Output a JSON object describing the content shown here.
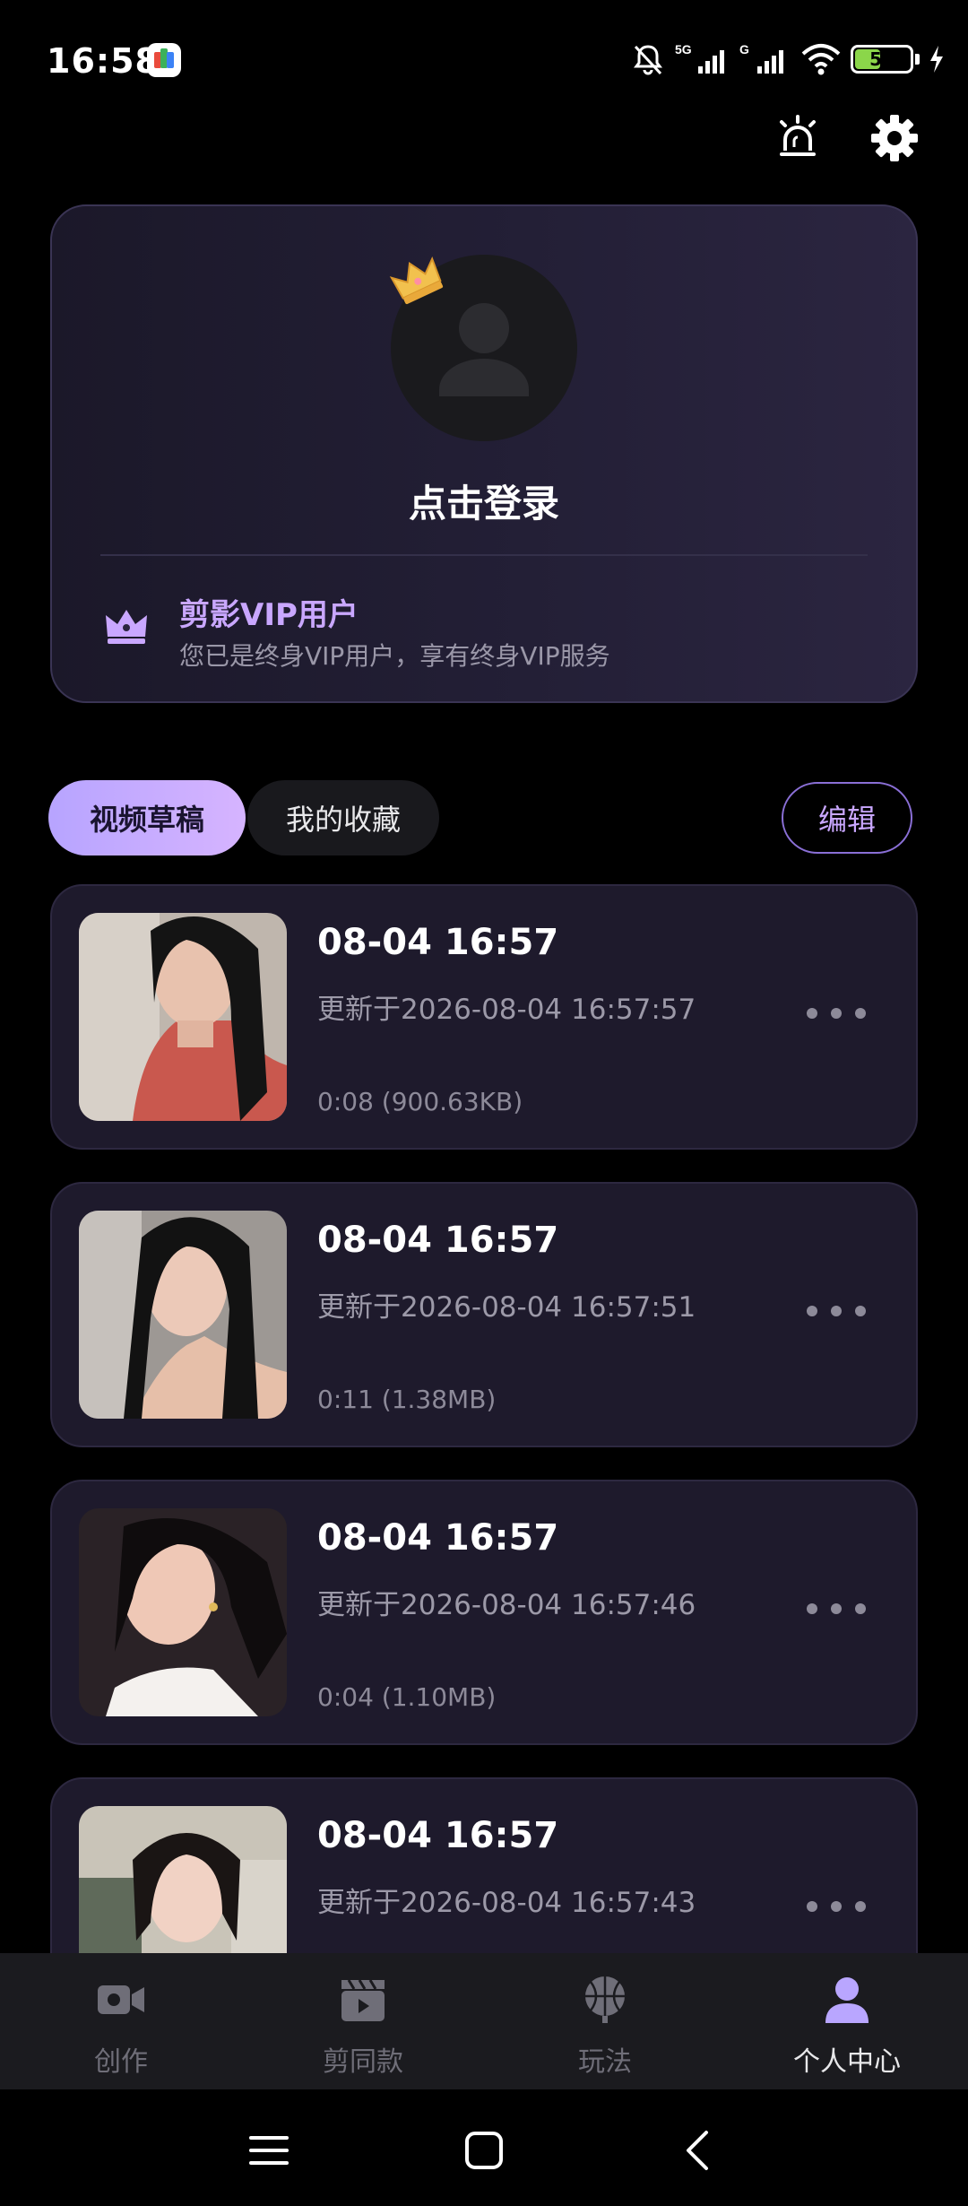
{
  "status_bar": {
    "time": "16:58",
    "network_1": "5G",
    "network_2": "G",
    "battery": "50",
    "battery_level": 0.5,
    "icons": [
      "app-notification-icon",
      "mute-bell-icon",
      "signal-icon",
      "wifi-icon",
      "battery-icon",
      "charging-icon"
    ]
  },
  "header": {
    "icons": [
      "alarm-light-icon",
      "settings-gear-icon"
    ]
  },
  "profile": {
    "login_label": "点击登录",
    "vip_title": "剪影VIP用户",
    "vip_subtitle": "您已是终身VIP用户，享有终身VIP服务",
    "accent_color": "#c9a7ff"
  },
  "tabs": {
    "items": [
      {
        "label": "视频草稿",
        "active": true
      },
      {
        "label": "我的收藏",
        "active": false
      }
    ],
    "edit_label": "编辑"
  },
  "drafts": [
    {
      "title": "08-04 16:57",
      "updated": "更新于2026-08-04 16:57:57",
      "meta": "0:08 (900.63KB)"
    },
    {
      "title": "08-04 16:57",
      "updated": "更新于2026-08-04 16:57:51",
      "meta": "0:11 (1.38MB)"
    },
    {
      "title": "08-04 16:57",
      "updated": "更新于2026-08-04 16:57:46",
      "meta": "0:04 (1.10MB)"
    },
    {
      "title": "08-04 16:57",
      "updated": "更新于2026-08-04 16:57:43",
      "meta": ""
    }
  ],
  "bottom_nav": {
    "items": [
      {
        "label": "创作",
        "icon": "video-camera-icon",
        "active": false
      },
      {
        "label": "剪同款",
        "icon": "clapperboard-icon",
        "active": false
      },
      {
        "label": "玩法",
        "icon": "basketball-icon",
        "active": false
      },
      {
        "label": "个人中心",
        "icon": "person-icon",
        "active": true
      }
    ]
  },
  "system_nav": {
    "icons": [
      "menu-icon",
      "home-icon",
      "back-icon"
    ]
  }
}
